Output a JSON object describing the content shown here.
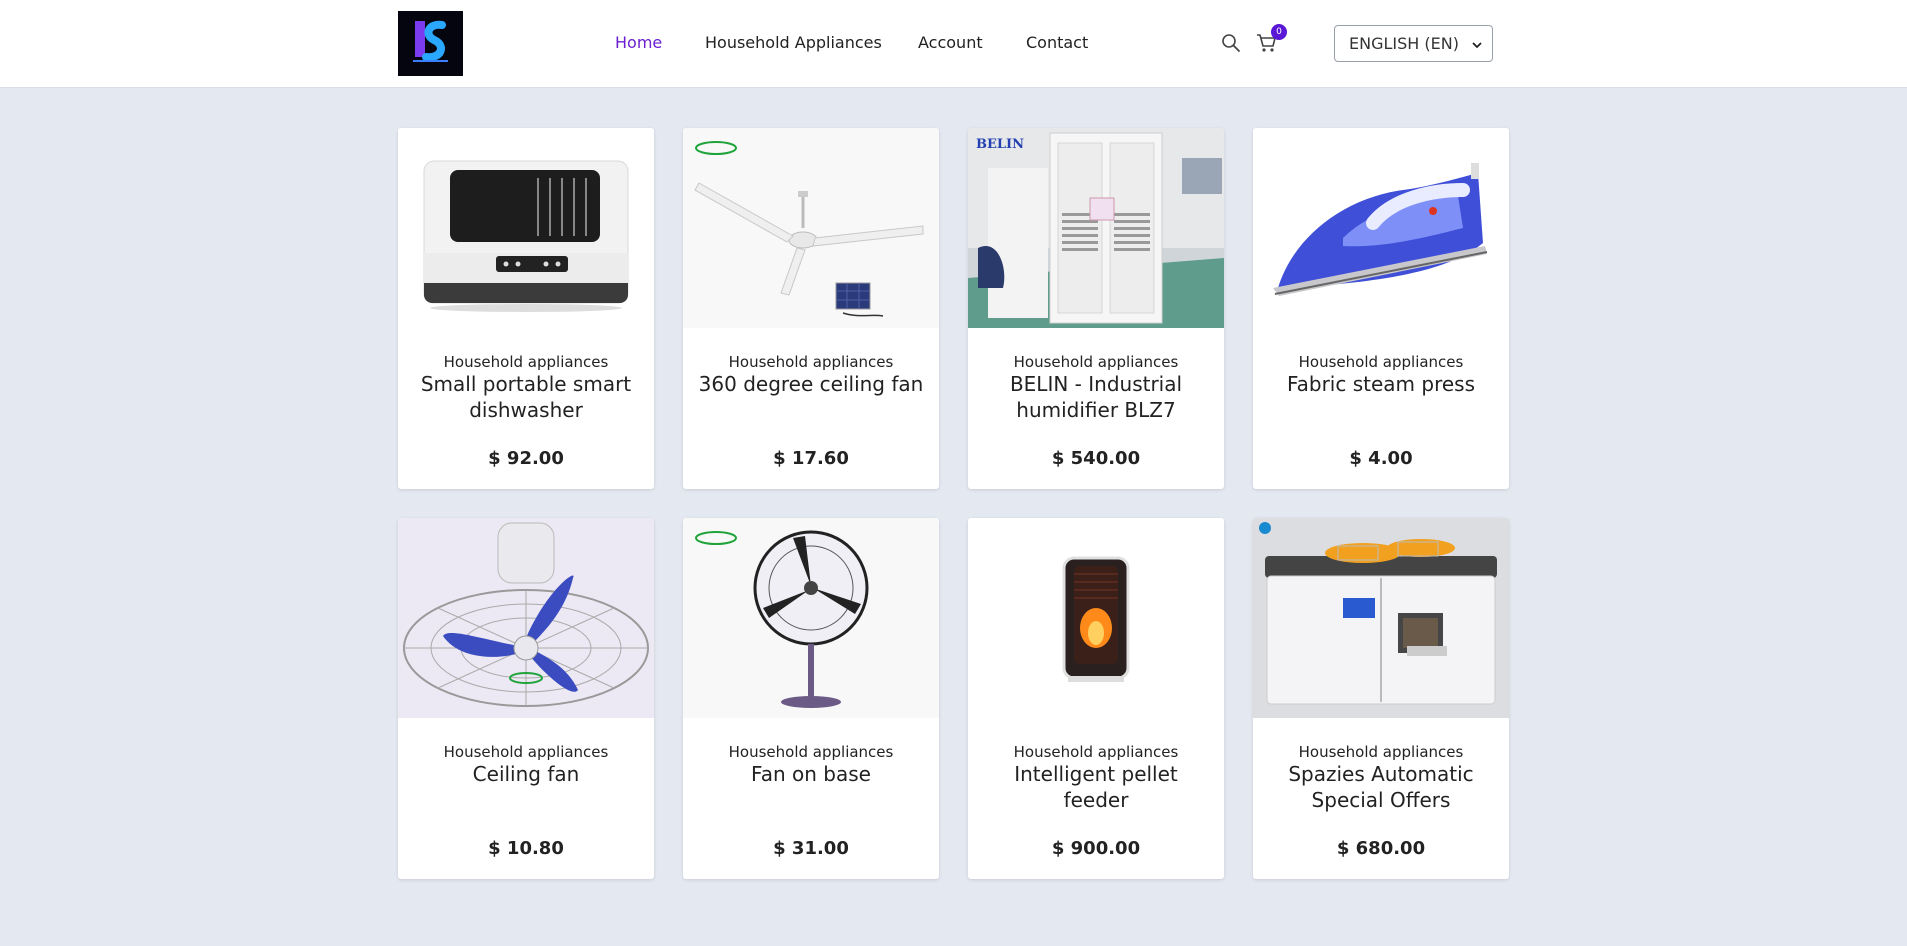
{
  "header": {
    "logo_text": "LS",
    "nav": [
      {
        "label": "Home",
        "active": true
      },
      {
        "label": "Household Appliances",
        "active": false
      },
      {
        "label": "Account",
        "active": false
      },
      {
        "label": "Contact",
        "active": false
      }
    ],
    "cart_count": "0",
    "language": "ENGLISH (EN)",
    "accent_color": "#6a1fd0"
  },
  "products": [
    {
      "category": "Household appliances",
      "name": "Small portable smart dishwasher",
      "price": "$ 92.00",
      "image": "dishwasher"
    },
    {
      "category": "Household appliances",
      "name": "360 degree ceiling fan",
      "price": "$ 17.60",
      "image": "ceiling-fan-solar"
    },
    {
      "category": "Household appliances",
      "name": "BELIN - Industrial humidifier BLZ7",
      "price": "$ 540.00",
      "image": "industrial-humidifier",
      "image_text": "BELIN"
    },
    {
      "category": "Household appliances",
      "name": "Fabric steam press",
      "price": "$ 4.00",
      "image": "steam-iron"
    },
    {
      "category": "Household appliances",
      "name": "Ceiling fan",
      "price": "$ 10.80",
      "image": "orbit-fan"
    },
    {
      "category": "Household appliances",
      "name": "Fan on base",
      "price": "$ 31.00",
      "image": "pedestal-fan"
    },
    {
      "category": "Household appliances",
      "name": "Intelligent pellet feeder",
      "price": "$ 900.00",
      "image": "pellet-stove"
    },
    {
      "category": "Household appliances",
      "name": "Spazies Automatic Special Offers",
      "price": "$ 680.00",
      "image": "automatic-machine"
    }
  ]
}
